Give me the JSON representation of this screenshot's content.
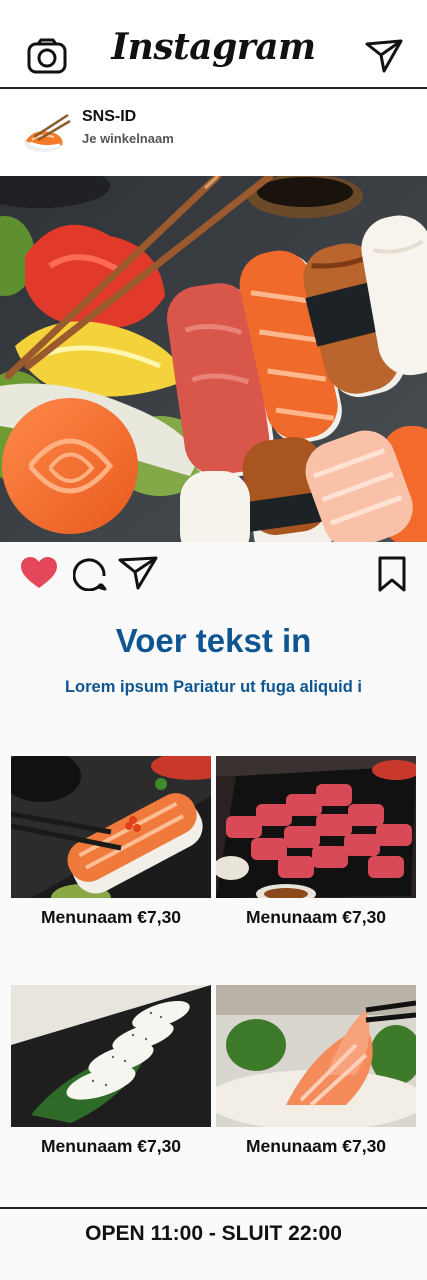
{
  "header": {
    "title": "Instagram",
    "left_icon": "camera-icon",
    "right_icon": "send-icon"
  },
  "profile": {
    "id": "SNS-ID",
    "shop_name": "Je winkelnaam"
  },
  "post_actions": {
    "like_icon": "heart-icon",
    "comment_icon": "comment-icon",
    "share_icon": "send-icon",
    "save_icon": "bookmark-icon",
    "like_color": "#e4475a"
  },
  "caption": {
    "headline": "Voer tekst in",
    "subline": "Lorem ipsum Pariatur ut fuga aliquid i"
  },
  "menu": [
    {
      "label": "Menunaam €7,30"
    },
    {
      "label": "Menunaam €7,30"
    },
    {
      "label": "Menunaam €7,30"
    },
    {
      "label": "Menunaam €7,30"
    }
  ],
  "footer": {
    "hours": "OPEN 11:00 - SLUIT 22:00"
  },
  "colors": {
    "accent": "#0e5693",
    "text": "#111111",
    "background": "#fafafa"
  }
}
